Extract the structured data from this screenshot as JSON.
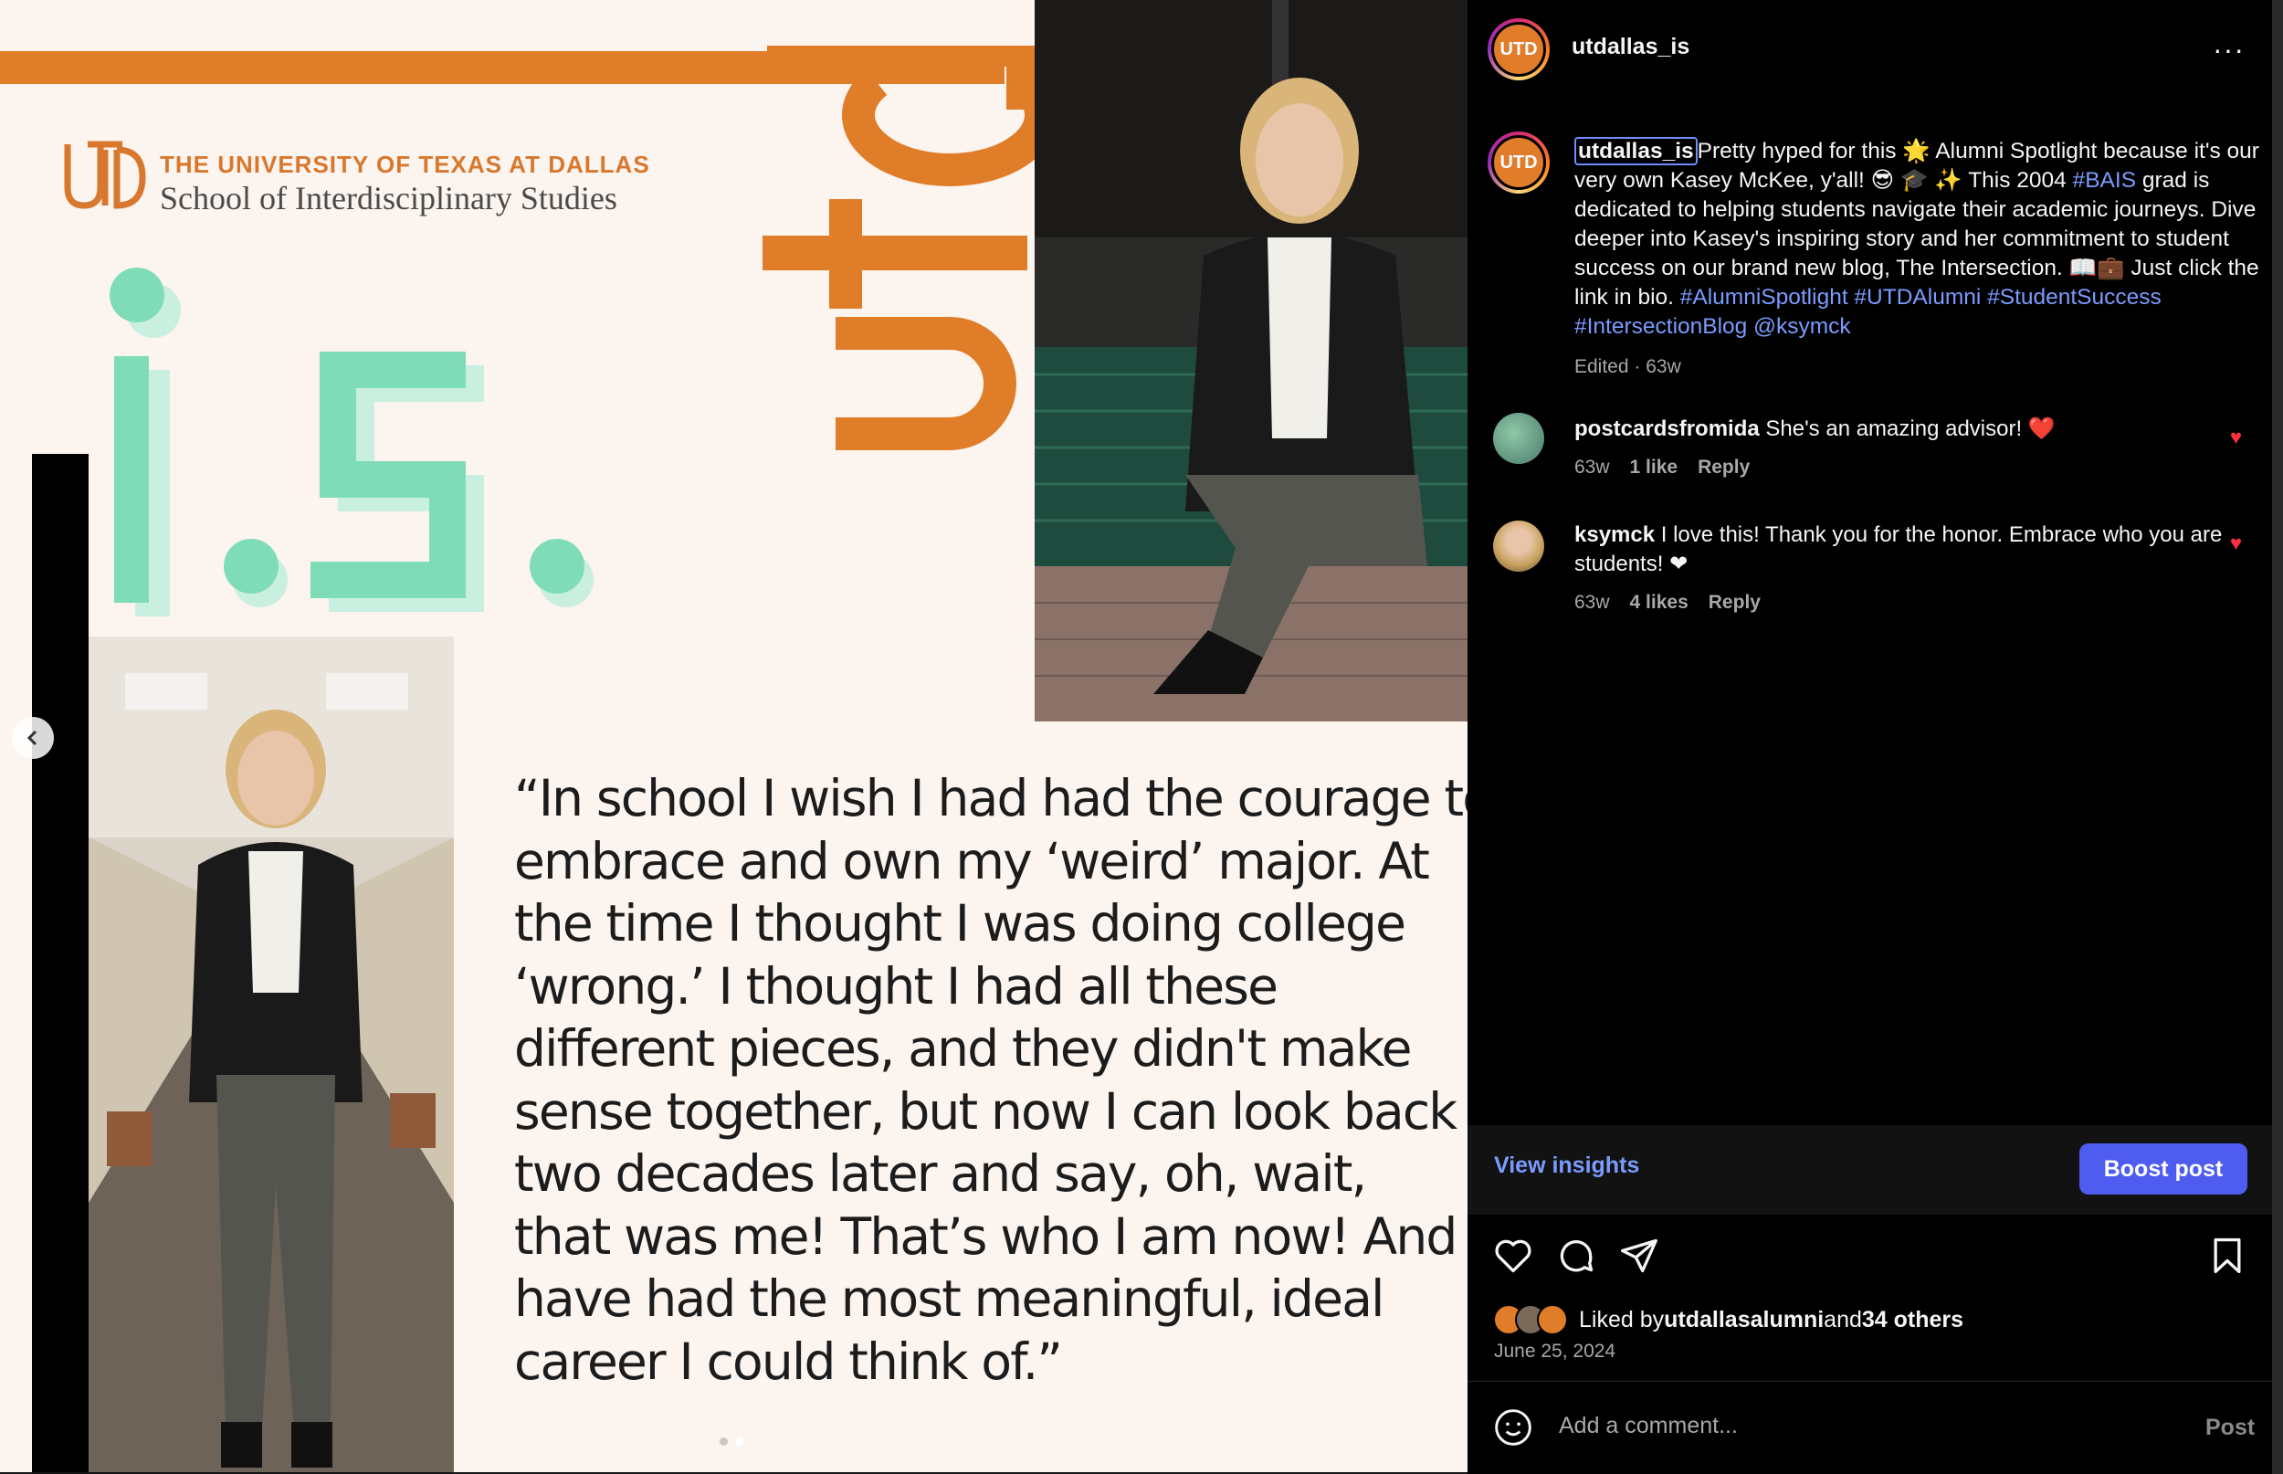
{
  "post": {
    "image": {
      "university_name": "THE UNIVERSITY OF TEXAS AT DALLAS",
      "school_name": "School of Interdisciplinary Studies",
      "quote_lines": [
        "“In school I wish I had had the courage to",
        "embrace and own my ‘weird’ major. At",
        "the time I thought I was doing college",
        "‘wrong.’ I thought I had all these",
        "different pieces, and they didn't make",
        "sense together, but now I can look back",
        "two decades later and say, oh, wait,",
        "that was me! That’s who I am now! And I",
        "have had the most meaningful, ideal",
        "career I could think of.”"
      ],
      "carousel_total": 2,
      "carousel_current": 2
    }
  },
  "header": {
    "username": "utdallas_is",
    "more_label": "···"
  },
  "caption": {
    "username": "utdallas_is",
    "part1": "Pretty hyped for this 🌟 Alumni Spotlight because it's our very own Kasey McKee, y'all! 😎 🎓 ✨ This 2004 ",
    "tag_bais": "#BAIS",
    "part2": " grad is dedicated to helping students navigate their academic journeys. Dive deeper into Kasey's inspiring story and her commitment to student success on our brand new blog, The Intersection. 📖💼 Just click the link in bio. ",
    "tags": "#AlumniSpotlight #UTDAlumni #StudentSuccess #IntersectionBlog @ksymck",
    "meta": "Edited · 63w"
  },
  "comments": [
    {
      "username": "postcardsfromida",
      "text": "She's an amazing advisor! ❤️",
      "age": "63w",
      "likes": "1 like",
      "reply": "Reply"
    },
    {
      "username": "ksymck",
      "text": "I love this! Thank you for the honor. Embrace who you are students! ❤",
      "age": "63w",
      "likes": "4 likes",
      "reply": "Reply"
    }
  ],
  "insights": {
    "view_label": "View insights",
    "boost_label": "Boost post"
  },
  "likes": {
    "prefix": "Liked by ",
    "user": "utdallasalumni",
    "middle": " and ",
    "others": "34 others"
  },
  "date": "June 25, 2024",
  "comment_box": {
    "placeholder": "Add a comment...",
    "post_label": "Post"
  },
  "colors": {
    "accent": "#e07d29",
    "mint": "#7fdcb8",
    "link": "#7b9cff",
    "boost": "#4e5cf0",
    "heart": "#ff3040"
  }
}
